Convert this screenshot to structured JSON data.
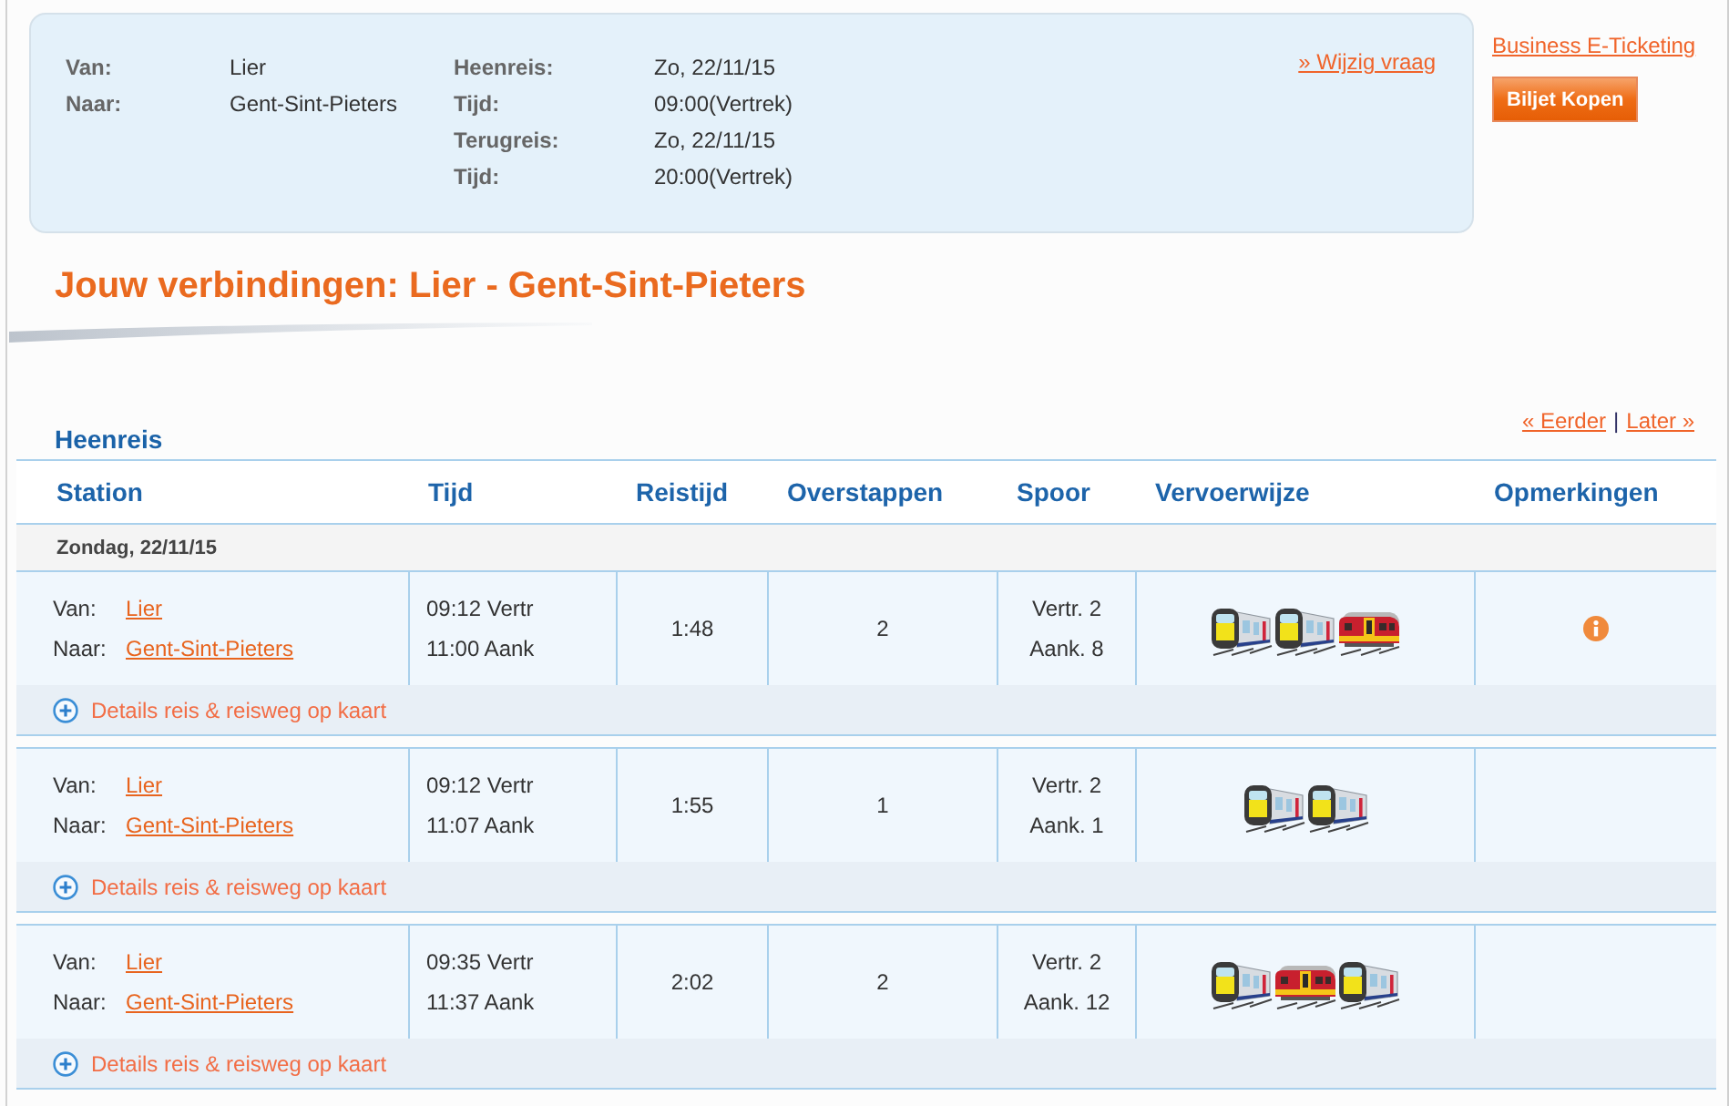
{
  "query": {
    "fields": [
      {
        "label": "Van:",
        "value": "Lier"
      },
      {
        "label": "Naar:",
        "value": "Gent-Sint-Pieters"
      }
    ],
    "trip": [
      {
        "label": "Heenreis:",
        "value": "Zo, 22/11/15"
      },
      {
        "label": "Tijd:",
        "value": "09:00(Vertrek)"
      },
      {
        "label": "Terugreis:",
        "value": "Zo, 22/11/15"
      },
      {
        "label": "Tijd:",
        "value": "20:00(Vertrek)"
      }
    ],
    "change_link": "» Wijzig vraag"
  },
  "sidebar": {
    "link": "Business E-Ticketing",
    "button": "Biljet Kopen"
  },
  "title": "Jouw verbindingen: Lier - Gent-Sint-Pieters",
  "pager": {
    "earlier": "« Eerder",
    "separator": "|",
    "later": "Later »"
  },
  "section": "Heenreis",
  "table": {
    "columns": [
      "Station",
      "Tijd",
      "Reistijd",
      "Overstappen",
      "Spoor",
      "Vervoerwijze",
      "Opmerkingen"
    ],
    "date": "Zondag, 22/11/15",
    "rows": [
      {
        "from_label": "Van:",
        "from": "Lier",
        "to_label": "Naar:",
        "to": "Gent-Sint-Pieters",
        "departure": "09:12 Vertr",
        "arrival": "11:00 Aank",
        "duration": "1:48",
        "transfers": "2",
        "platform_from": "Vertr. 2",
        "platform_to": "Aank. 8",
        "legs": [
          {
            "kind": "silver"
          },
          {
            "kind": "silver"
          },
          {
            "kind": "red"
          }
        ],
        "remark": true,
        "details": "Details reis & reisweg op kaart"
      },
      {
        "from_label": "Van:",
        "from": "Lier",
        "to_label": "Naar:",
        "to": "Gent-Sint-Pieters",
        "departure": "09:12 Vertr",
        "arrival": "11:07 Aank",
        "duration": "1:55",
        "transfers": "1",
        "platform_from": "Vertr. 2",
        "platform_to": "Aank. 1",
        "legs": [
          {
            "kind": "silver"
          },
          {
            "kind": "silver"
          }
        ],
        "remark": false,
        "details": "Details reis & reisweg op kaart"
      },
      {
        "from_label": "Van:",
        "from": "Lier",
        "to_label": "Naar:",
        "to": "Gent-Sint-Pieters",
        "departure": "09:35 Vertr",
        "arrival": "11:37 Aank",
        "duration": "2:02",
        "transfers": "2",
        "platform_from": "Vertr. 2",
        "platform_to": "Aank. 12",
        "legs": [
          {
            "kind": "silver"
          },
          {
            "kind": "red"
          },
          {
            "kind": "silver"
          }
        ],
        "remark": false,
        "details": "Details reis & reisweg op kaart"
      }
    ]
  }
}
